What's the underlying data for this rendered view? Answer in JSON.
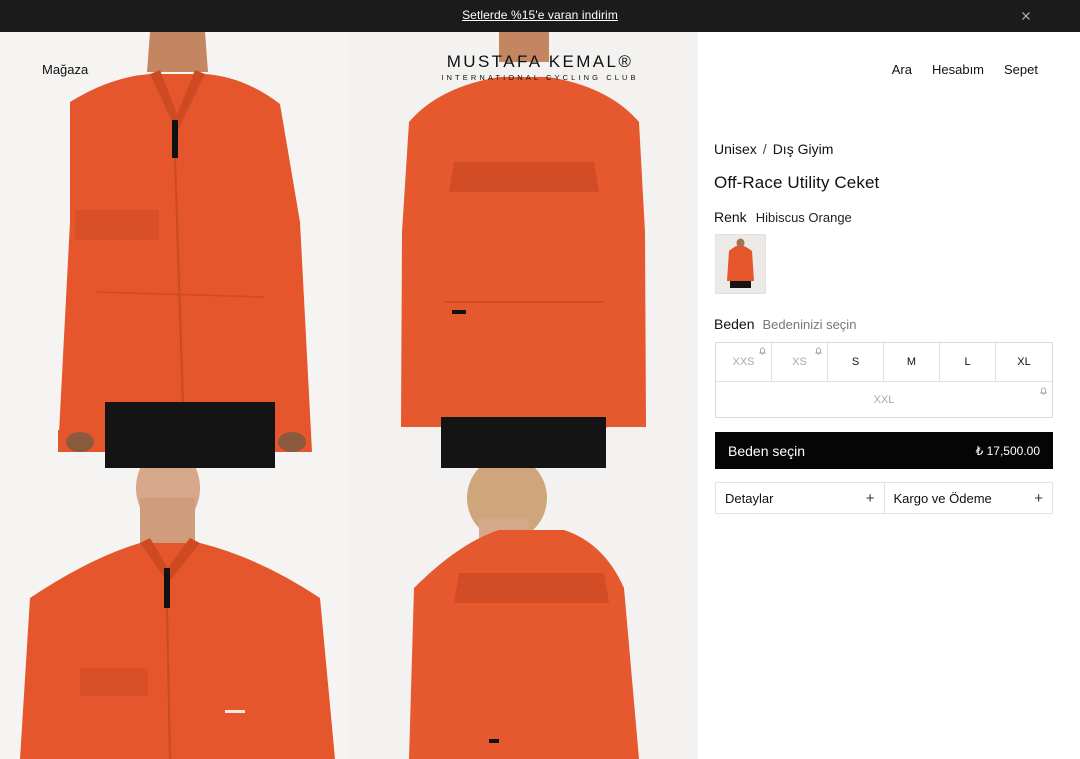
{
  "announcement": {
    "text": "Setlerde %15'e varan indirim"
  },
  "header": {
    "shop": "Mağaza",
    "logo_main": "MUSTAFA KEMAL®",
    "logo_sub": "INTERNATIONAL CYCLING CLUB",
    "search": "Ara",
    "account": "Hesabım",
    "cart": "Sepet"
  },
  "breadcrumb": {
    "items": [
      "Unisex",
      "Dış Giyim"
    ],
    "separator": "/"
  },
  "product": {
    "title": "Off-Race Utility Ceket",
    "color_label": "Renk",
    "color_value": "Hibiscus Orange",
    "size_label": "Beden",
    "size_hint": "Bedeninizi seçin",
    "sizes": [
      {
        "label": "XXS",
        "available": false
      },
      {
        "label": "XS",
        "available": false
      },
      {
        "label": "S",
        "available": true
      },
      {
        "label": "M",
        "available": true
      },
      {
        "label": "L",
        "available": true
      },
      {
        "label": "XL",
        "available": true
      },
      {
        "label": "XXL",
        "available": false
      }
    ],
    "cta_label": "Beden seçin",
    "price": "₺ 17,500.00"
  },
  "accordions": {
    "details": "Detaylar",
    "shipping": "Kargo ve Ödeme"
  },
  "colors": {
    "jacket": "#e8572e",
    "topbar": "#1b1b1b",
    "cta": "#050505"
  },
  "icons": {
    "close": "close-icon",
    "notify": "bell-icon",
    "expand": "plus-icon"
  }
}
